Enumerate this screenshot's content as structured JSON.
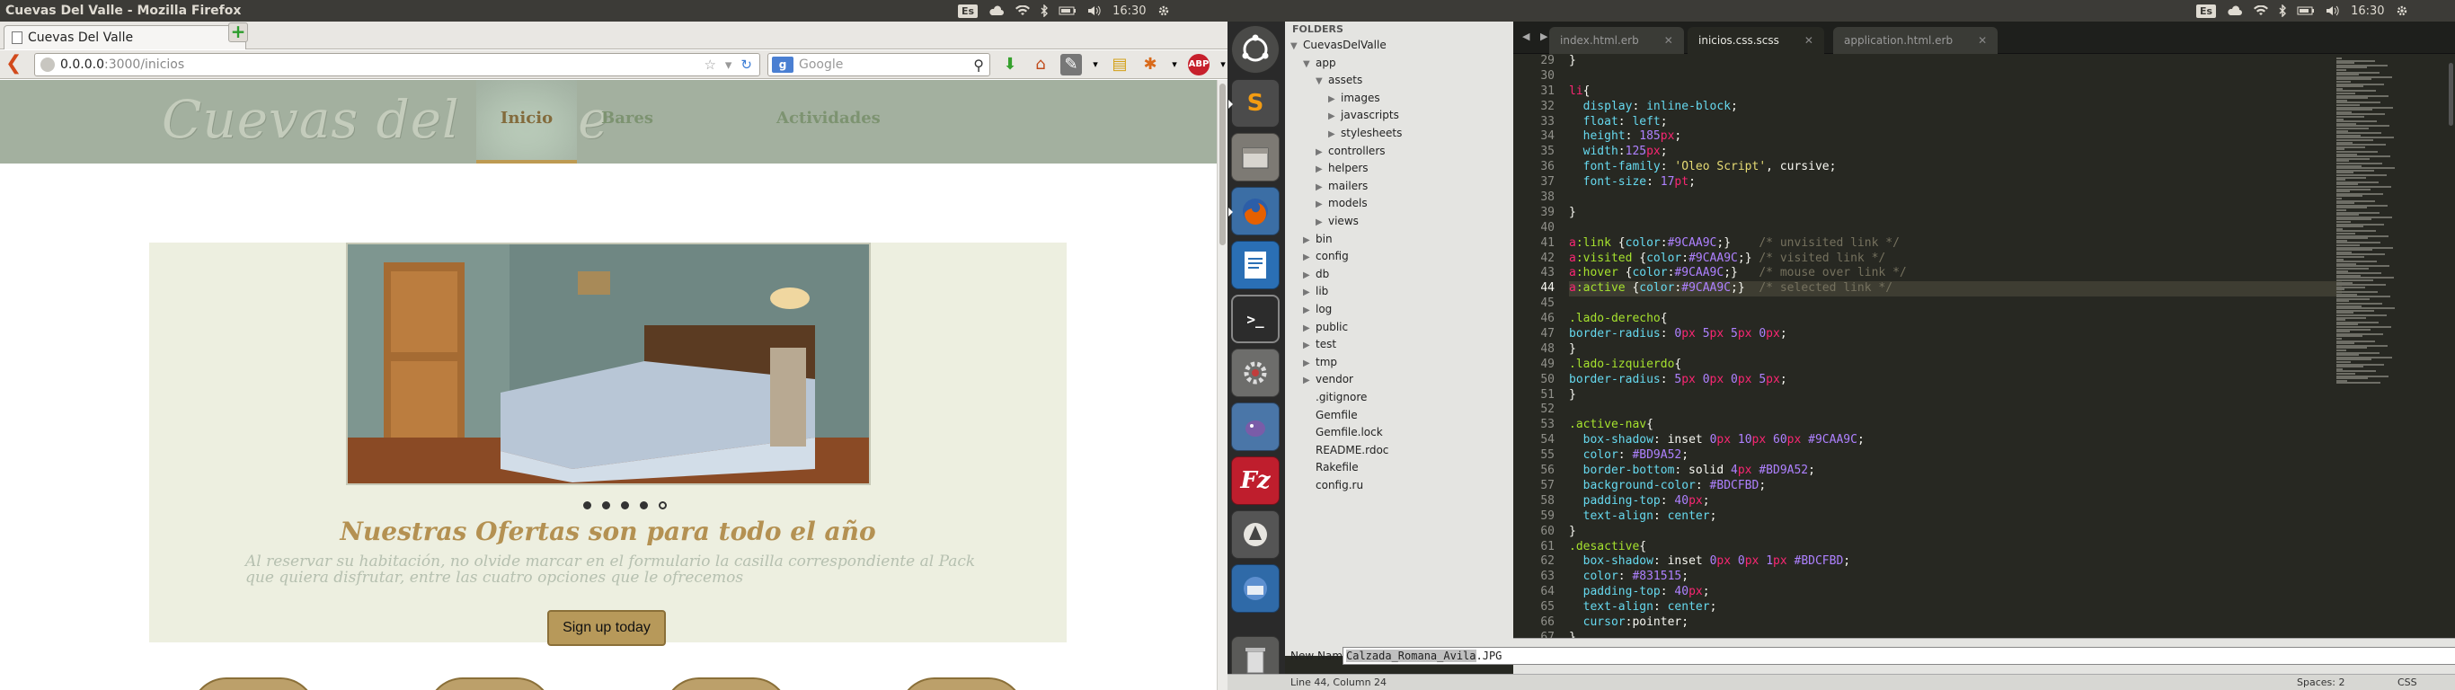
{
  "firefox": {
    "window_title": "Cuevas Del Valle - Mozilla Firefox",
    "tab_title": "Cuevas Del Valle",
    "new_tab_label": "+",
    "url_host": "0.0.0.0",
    "url_path": ":3000/inicios",
    "search_placeholder": "Google",
    "search_engine_badge": "g"
  },
  "system_tray": {
    "keyboard_layout": "Es",
    "clock": "16:30",
    "icons": [
      "cloud-icon",
      "wifi-icon",
      "bluetooth-icon",
      "battery-icon",
      "volume-icon",
      "gear-icon"
    ]
  },
  "site": {
    "logo": "Cuevas del Valle",
    "nav": [
      {
        "label": "Inicio",
        "active": true
      },
      {
        "label": "Bares",
        "active": false
      },
      {
        "label": "Actividades",
        "active": false
      }
    ],
    "promo_title": "Nuestras Ofertas son para todo el año",
    "promo_text": "Al reservar su habitación, no olvide marcar en el formulario la casilla correspondiente al Pack que quiera disfrutar, entre las cuatro opciones que le ofrecemos",
    "signup_label": "Sign up today",
    "carousel_dots": 5,
    "carousel_active": 5
  },
  "launcher": {
    "apps": [
      "ubuntu-dash-icon",
      "sublime-text-icon",
      "files-icon",
      "firefox-icon",
      "libreoffice-writer-icon",
      "terminal-icon",
      "system-settings-icon",
      "pidgin-icon",
      "filezilla-icon",
      "update-manager-icon",
      "thunderbird-icon",
      "trash-icon"
    ]
  },
  "sublime": {
    "folders_header": "FOLDERS",
    "tree": [
      {
        "label": "CuevasDelValle",
        "depth": 0,
        "twisty": "▼"
      },
      {
        "label": "app",
        "depth": 1,
        "twisty": "▼"
      },
      {
        "label": "assets",
        "depth": 2,
        "twisty": "▼"
      },
      {
        "label": "images",
        "depth": 3,
        "twisty": "▶"
      },
      {
        "label": "javascripts",
        "depth": 3,
        "twisty": "▶"
      },
      {
        "label": "stylesheets",
        "depth": 3,
        "twisty": "▶"
      },
      {
        "label": "controllers",
        "depth": 2,
        "twisty": "▶"
      },
      {
        "label": "helpers",
        "depth": 2,
        "twisty": "▶"
      },
      {
        "label": "mailers",
        "depth": 2,
        "twisty": "▶"
      },
      {
        "label": "models",
        "depth": 2,
        "twisty": "▶"
      },
      {
        "label": "views",
        "depth": 2,
        "twisty": "▶"
      },
      {
        "label": "bin",
        "depth": 1,
        "twisty": "▶"
      },
      {
        "label": "config",
        "depth": 1,
        "twisty": "▶"
      },
      {
        "label": "db",
        "depth": 1,
        "twisty": "▶"
      },
      {
        "label": "lib",
        "depth": 1,
        "twisty": "▶"
      },
      {
        "label": "log",
        "depth": 1,
        "twisty": "▶"
      },
      {
        "label": "public",
        "depth": 1,
        "twisty": "▶"
      },
      {
        "label": "test",
        "depth": 1,
        "twisty": "▶"
      },
      {
        "label": "tmp",
        "depth": 1,
        "twisty": "▶"
      },
      {
        "label": "vendor",
        "depth": 1,
        "twisty": "▶"
      },
      {
        "label": ".gitignore",
        "depth": 1,
        "twisty": ""
      },
      {
        "label": "Gemfile",
        "depth": 1,
        "twisty": ""
      },
      {
        "label": "Gemfile.lock",
        "depth": 1,
        "twisty": ""
      },
      {
        "label": "README.rdoc",
        "depth": 1,
        "twisty": ""
      },
      {
        "label": "Rakefile",
        "depth": 1,
        "twisty": ""
      },
      {
        "label": "config.ru",
        "depth": 1,
        "twisty": ""
      }
    ],
    "tabs": [
      {
        "label": "index.html.erb",
        "active": false
      },
      {
        "label": "inicios.css.scss",
        "active": true
      },
      {
        "label": "application.html.erb",
        "active": false
      }
    ],
    "first_line": 29,
    "current_line": 44,
    "code": [
      [
        [
          "t-pl",
          "}"
        ]
      ],
      [],
      [
        [
          "t-sel",
          "li"
        ],
        [
          "t-pl",
          "{"
        ]
      ],
      [
        [
          "t-pl",
          "  "
        ],
        [
          "t-prop",
          "display"
        ],
        [
          "t-pl",
          ": "
        ],
        [
          "t-prop",
          "inline-block"
        ],
        [
          "t-pl",
          ";"
        ]
      ],
      [
        [
          "t-pl",
          "  "
        ],
        [
          "t-prop",
          "float"
        ],
        [
          "t-pl",
          ": "
        ],
        [
          "t-prop",
          "left"
        ],
        [
          "t-pl",
          ";"
        ]
      ],
      [
        [
          "t-pl",
          "  "
        ],
        [
          "t-prop",
          "height"
        ],
        [
          "t-pl",
          ": "
        ],
        [
          "t-num",
          "185"
        ],
        [
          "t-sel",
          "px"
        ],
        [
          "t-pl",
          ";"
        ]
      ],
      [
        [
          "t-pl",
          "  "
        ],
        [
          "t-prop",
          "width"
        ],
        [
          "t-pl",
          ":"
        ],
        [
          "t-num",
          "125"
        ],
        [
          "t-sel",
          "px"
        ],
        [
          "t-pl",
          ";"
        ]
      ],
      [
        [
          "t-pl",
          "  "
        ],
        [
          "t-prop",
          "font-family"
        ],
        [
          "t-pl",
          ": "
        ],
        [
          "t-str",
          "'Oleo Script'"
        ],
        [
          "t-pl",
          ", cursive;"
        ]
      ],
      [
        [
          "t-pl",
          "  "
        ],
        [
          "t-prop",
          "font-size"
        ],
        [
          "t-pl",
          ": "
        ],
        [
          "t-num",
          "17"
        ],
        [
          "t-sel",
          "pt"
        ],
        [
          "t-pl",
          ";"
        ]
      ],
      [],
      [
        [
          "t-pl",
          "}"
        ]
      ],
      [],
      [
        [
          "t-sel",
          "a"
        ],
        [
          "t-cls",
          ":link"
        ],
        [
          "t-pl",
          " {"
        ],
        [
          "t-prop",
          "color"
        ],
        [
          "t-pl",
          ":"
        ],
        [
          "t-num",
          "#9CAA9C"
        ],
        [
          "t-pl",
          ";}    "
        ],
        [
          "t-com",
          "/* unvisited link */"
        ]
      ],
      [
        [
          "t-sel",
          "a"
        ],
        [
          "t-cls",
          ":visited"
        ],
        [
          "t-pl",
          " {"
        ],
        [
          "t-prop",
          "color"
        ],
        [
          "t-pl",
          ":"
        ],
        [
          "t-num",
          "#9CAA9C"
        ],
        [
          "t-pl",
          ";} "
        ],
        [
          "t-com",
          "/* visited link */"
        ]
      ],
      [
        [
          "t-sel",
          "a"
        ],
        [
          "t-cls",
          ":hover"
        ],
        [
          "t-pl",
          " {"
        ],
        [
          "t-prop",
          "color"
        ],
        [
          "t-pl",
          ":"
        ],
        [
          "t-num",
          "#9CAA9C"
        ],
        [
          "t-pl",
          ";}   "
        ],
        [
          "t-com",
          "/* mouse over link */"
        ]
      ],
      [
        [
          "t-sel",
          "a"
        ],
        [
          "t-cls",
          ":active"
        ],
        [
          "t-pl",
          " {"
        ],
        [
          "t-prop",
          "color"
        ],
        [
          "t-pl",
          ":"
        ],
        [
          "t-num",
          "#9CAA9C"
        ],
        [
          "t-pl",
          ";}  "
        ],
        [
          "t-com",
          "/* selected link */"
        ]
      ],
      [],
      [
        [
          "t-cls",
          ".lado-derecho"
        ],
        [
          "t-pl",
          "{"
        ]
      ],
      [
        [
          "t-prop",
          "border-radius"
        ],
        [
          "t-pl",
          ": "
        ],
        [
          "t-num",
          "0"
        ],
        [
          "t-sel",
          "px"
        ],
        [
          "t-pl",
          " "
        ],
        [
          "t-num",
          "5"
        ],
        [
          "t-sel",
          "px"
        ],
        [
          "t-pl",
          " "
        ],
        [
          "t-num",
          "5"
        ],
        [
          "t-sel",
          "px"
        ],
        [
          "t-pl",
          " "
        ],
        [
          "t-num",
          "0"
        ],
        [
          "t-sel",
          "px"
        ],
        [
          "t-pl",
          ";"
        ]
      ],
      [
        [
          "t-pl",
          "}"
        ]
      ],
      [
        [
          "t-cls",
          ".lado-izquierdo"
        ],
        [
          "t-pl",
          "{"
        ]
      ],
      [
        [
          "t-prop",
          "border-radius"
        ],
        [
          "t-pl",
          ": "
        ],
        [
          "t-num",
          "5"
        ],
        [
          "t-sel",
          "px"
        ],
        [
          "t-pl",
          " "
        ],
        [
          "t-num",
          "0"
        ],
        [
          "t-sel",
          "px"
        ],
        [
          "t-pl",
          " "
        ],
        [
          "t-num",
          "0"
        ],
        [
          "t-sel",
          "px"
        ],
        [
          "t-pl",
          " "
        ],
        [
          "t-num",
          "5"
        ],
        [
          "t-sel",
          "px"
        ],
        [
          "t-pl",
          ";"
        ]
      ],
      [
        [
          "t-pl",
          "}"
        ]
      ],
      [],
      [
        [
          "t-cls",
          ".active-nav"
        ],
        [
          "t-pl",
          "{"
        ]
      ],
      [
        [
          "t-pl",
          "  "
        ],
        [
          "t-prop",
          "box-shadow"
        ],
        [
          "t-pl",
          ": inset "
        ],
        [
          "t-num",
          "0"
        ],
        [
          "t-sel",
          "px"
        ],
        [
          "t-pl",
          " "
        ],
        [
          "t-num",
          "10"
        ],
        [
          "t-sel",
          "px"
        ],
        [
          "t-pl",
          " "
        ],
        [
          "t-num",
          "60"
        ],
        [
          "t-sel",
          "px"
        ],
        [
          "t-pl",
          " "
        ],
        [
          "t-num",
          "#9CAA9C"
        ],
        [
          "t-pl",
          ";"
        ]
      ],
      [
        [
          "t-pl",
          "  "
        ],
        [
          "t-prop",
          "color"
        ],
        [
          "t-pl",
          ": "
        ],
        [
          "t-num",
          "#BD9A52"
        ],
        [
          "t-pl",
          ";"
        ]
      ],
      [
        [
          "t-pl",
          "  "
        ],
        [
          "t-prop",
          "border-bottom"
        ],
        [
          "t-pl",
          ": solid "
        ],
        [
          "t-num",
          "4"
        ],
        [
          "t-sel",
          "px"
        ],
        [
          "t-pl",
          " "
        ],
        [
          "t-num",
          "#BD9A52"
        ],
        [
          "t-pl",
          ";"
        ]
      ],
      [
        [
          "t-pl",
          "  "
        ],
        [
          "t-prop",
          "background-color"
        ],
        [
          "t-pl",
          ": "
        ],
        [
          "t-num",
          "#BDCFBD"
        ],
        [
          "t-pl",
          ";"
        ]
      ],
      [
        [
          "t-pl",
          "  "
        ],
        [
          "t-prop",
          "padding-top"
        ],
        [
          "t-pl",
          ": "
        ],
        [
          "t-num",
          "40"
        ],
        [
          "t-sel",
          "px"
        ],
        [
          "t-pl",
          ";"
        ]
      ],
      [
        [
          "t-pl",
          "  "
        ],
        [
          "t-prop",
          "text-align"
        ],
        [
          "t-pl",
          ": "
        ],
        [
          "t-prop",
          "center"
        ],
        [
          "t-pl",
          ";"
        ]
      ],
      [
        [
          "t-pl",
          "}"
        ]
      ],
      [
        [
          "t-cls",
          ".desactive"
        ],
        [
          "t-pl",
          "{"
        ]
      ],
      [
        [
          "t-pl",
          "  "
        ],
        [
          "t-prop",
          "box-shadow"
        ],
        [
          "t-pl",
          ": inset "
        ],
        [
          "t-num",
          "0"
        ],
        [
          "t-sel",
          "px"
        ],
        [
          "t-pl",
          " "
        ],
        [
          "t-num",
          "0"
        ],
        [
          "t-sel",
          "px"
        ],
        [
          "t-pl",
          " "
        ],
        [
          "t-num",
          "1"
        ],
        [
          "t-sel",
          "px"
        ],
        [
          "t-pl",
          " "
        ],
        [
          "t-num",
          "#BDCFBD"
        ],
        [
          "t-pl",
          ";"
        ]
      ],
      [
        [
          "t-pl",
          "  "
        ],
        [
          "t-prop",
          "color"
        ],
        [
          "t-pl",
          ": "
        ],
        [
          "t-num",
          "#831515"
        ],
        [
          "t-pl",
          ";"
        ]
      ],
      [
        [
          "t-pl",
          "  "
        ],
        [
          "t-prop",
          "padding-top"
        ],
        [
          "t-pl",
          ": "
        ],
        [
          "t-num",
          "40"
        ],
        [
          "t-sel",
          "px"
        ],
        [
          "t-pl",
          ";"
        ]
      ],
      [
        [
          "t-pl",
          "  "
        ],
        [
          "t-prop",
          "text-align"
        ],
        [
          "t-pl",
          ": "
        ],
        [
          "t-prop",
          "center"
        ],
        [
          "t-pl",
          ";"
        ]
      ],
      [
        [
          "t-pl",
          "  "
        ],
        [
          "t-prop",
          "cursor"
        ],
        [
          "t-pl",
          ":pointer;"
        ]
      ],
      [
        [
          "t-pl",
          "}"
        ]
      ]
    ],
    "new_name_label": "New Name:",
    "new_name_value": "Calzada_Romana_Avila.JPG",
    "new_name_selected": "Calzada_Romana_Avila",
    "new_name_ext": ".JPG",
    "status_position": "Line 44, Column 24",
    "status_spaces": "Spaces: 2",
    "status_syntax": "CSS"
  },
  "colors": {
    "header_bg": "#A3B09F",
    "active_nav_bg": "#BDCFBD",
    "accent_gold": "#BD9A52",
    "promo_bg": "#EDEFE0",
    "editor_bg": "#272822"
  }
}
